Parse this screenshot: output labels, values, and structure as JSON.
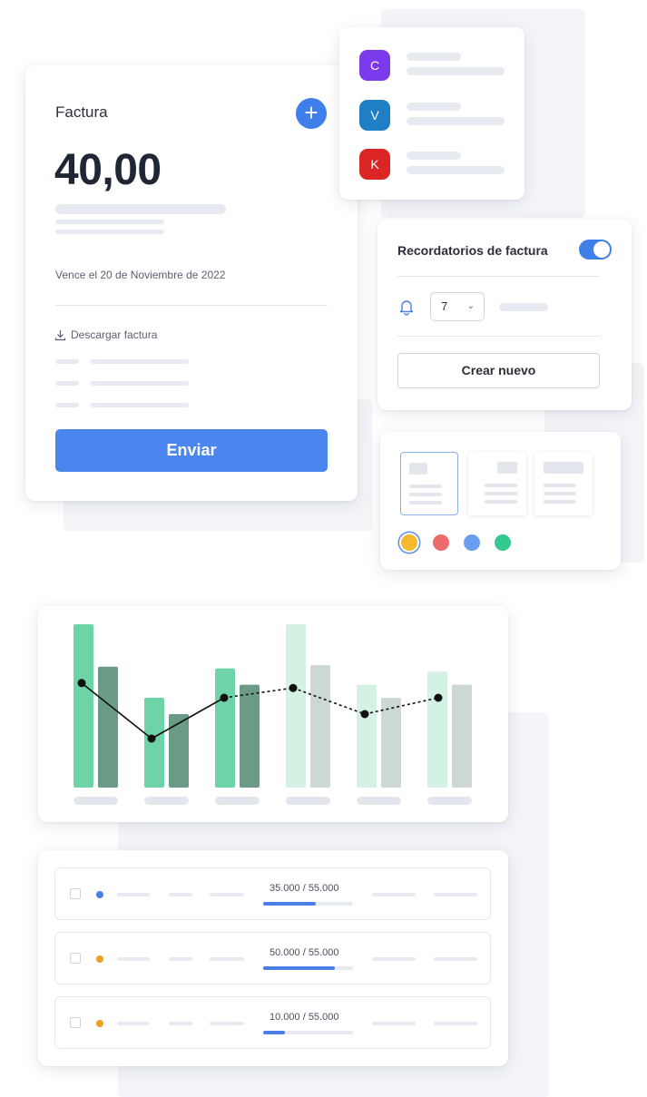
{
  "invoice": {
    "title": "Factura",
    "amount": "40,00",
    "due_text": "Vence el 20 de Noviembre de 2022",
    "download_label": "Descargar factura",
    "send_label": "Enviar",
    "add_icon": "plus-icon"
  },
  "contacts": [
    {
      "initial": "C",
      "color": "#7c3aed"
    },
    {
      "initial": "V",
      "color": "#1f7fc4"
    },
    {
      "initial": "K",
      "color": "#dc2626"
    }
  ],
  "reminders": {
    "title": "Recordatorios de factura",
    "toggle_on": true,
    "days_value": "7",
    "create_label": "Crear nuevo"
  },
  "template_colors": [
    "#f5b82e",
    "#ef6b6b",
    "#6b9ef2",
    "#34c98e"
  ],
  "selected_color_index": 0,
  "chart_data": {
    "type": "bar",
    "categories": [
      "",
      "",
      "",
      "",
      "",
      ""
    ],
    "series": [
      {
        "values": [
          100,
          55,
          73,
          100,
          63,
          71
        ]
      },
      {
        "values": [
          74,
          45,
          63,
          75,
          55,
          63
        ]
      },
      {
        "values": [
          64,
          30,
          55,
          61,
          45,
          55
        ],
        "type": "line"
      }
    ],
    "ylim": [
      0,
      100
    ],
    "grid": false
  },
  "table": {
    "rows": [
      {
        "label": "35.000 / 55.000",
        "progress": 0.59,
        "dot_color": "#4a7fe6"
      },
      {
        "label": "50.000 / 55.000",
        "progress": 0.8,
        "dot_color": "#f0a020"
      },
      {
        "label": "10.000 / 55.000",
        "progress": 0.24,
        "dot_color": "#f0a020"
      }
    ]
  }
}
